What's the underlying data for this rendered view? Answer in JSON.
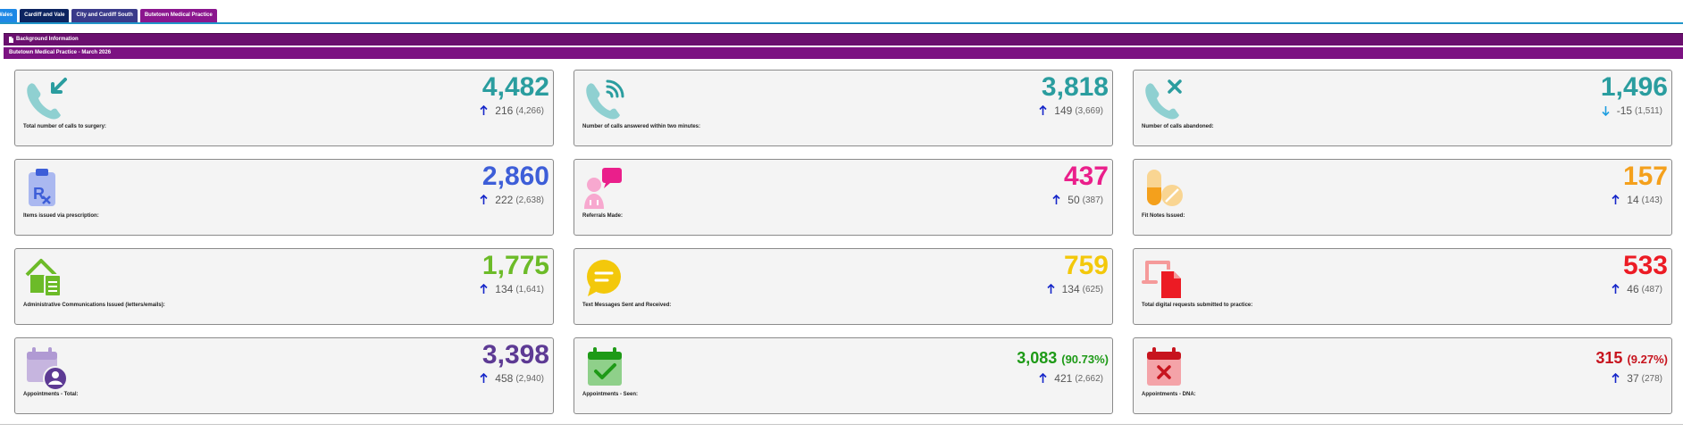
{
  "tabs": [
    {
      "label": "Wales",
      "color": "#1e88e5"
    },
    {
      "label": "Cardiff and Vale",
      "color": "#0c2460"
    },
    {
      "label": "City and Cardiff South",
      "color": "#3a3a8a"
    },
    {
      "label": "Butetown Medical Practice",
      "color": "#8b168e"
    }
  ],
  "sections": {
    "background": "Background Information",
    "practice": "Butetown Medical Practice - March 2026"
  },
  "cards": [
    {
      "icon": "phone-incoming-icon",
      "color": "#2a9d9f",
      "value": "4,482",
      "pct": "",
      "change": "216",
      "prev": "(4,266)",
      "trend": "up",
      "label": "Total number of calls to surgery:"
    },
    {
      "icon": "phone-answered-icon",
      "color": "#2a9d9f",
      "value": "3,818",
      "pct": "",
      "change": "149",
      "prev": "(3,669)",
      "trend": "up",
      "label": "Number of calls answered within two minutes:"
    },
    {
      "icon": "phone-abandoned-icon",
      "color": "#2a9d9f",
      "value": "1,496",
      "pct": "",
      "change": "-15",
      "prev": "(1,511)",
      "trend": "down",
      "label": "Number of calls abandoned:"
    },
    {
      "icon": "prescription-icon",
      "color": "#3d5ed8",
      "value": "2,860",
      "pct": "",
      "change": "222",
      "prev": "(2,638)",
      "trend": "up",
      "label": "Items issued via prescription:"
    },
    {
      "icon": "referral-icon",
      "color": "#ea1f8b",
      "value": "437",
      "pct": "",
      "change": "50",
      "prev": "(387)",
      "trend": "up",
      "label": "Referrals Made:"
    },
    {
      "icon": "pills-icon",
      "color": "#f4a01c",
      "value": "157",
      "pct": "",
      "change": "14",
      "prev": "(143)",
      "trend": "up",
      "label": "Fit Notes Issued:"
    },
    {
      "icon": "mail-house-icon",
      "color": "#6cbb28",
      "value": "1,775",
      "pct": "",
      "change": "134",
      "prev": "(1,641)",
      "trend": "up",
      "label": "Administrative Communications Issued (letters/emails):"
    },
    {
      "icon": "chat-bubble-icon",
      "color": "#f3c80b",
      "value": "759",
      "pct": "",
      "change": "134",
      "prev": "(625)",
      "trend": "up",
      "label": "Text Messages Sent and Received:"
    },
    {
      "icon": "digital-request-icon",
      "color": "#ec1b24",
      "value": "533",
      "pct": "",
      "change": "46",
      "prev": "(487)",
      "trend": "up",
      "label": "Total digital requests submitted to practice:"
    },
    {
      "icon": "calendar-user-icon",
      "color": "#5d3a94",
      "value": "3,398",
      "pct": "",
      "change": "458",
      "prev": "(2,940)",
      "trend": "up",
      "label": "Appointments - Total:"
    },
    {
      "icon": "calendar-check-icon",
      "color": "#1e9a17",
      "value": "3,083",
      "pct": "(90.73%)",
      "change": "421",
      "prev": "(2,662)",
      "trend": "up",
      "label": "Appointments - Seen:"
    },
    {
      "icon": "calendar-x-icon",
      "color": "#c7141e",
      "value": "315",
      "pct": "(9.27%)",
      "change": "37",
      "prev": "(278)",
      "trend": "up",
      "label": "Appointments - DNA:"
    }
  ],
  "colors": {
    "arrow_up": "#1627c9",
    "arrow_down": "#1e9ee0"
  }
}
